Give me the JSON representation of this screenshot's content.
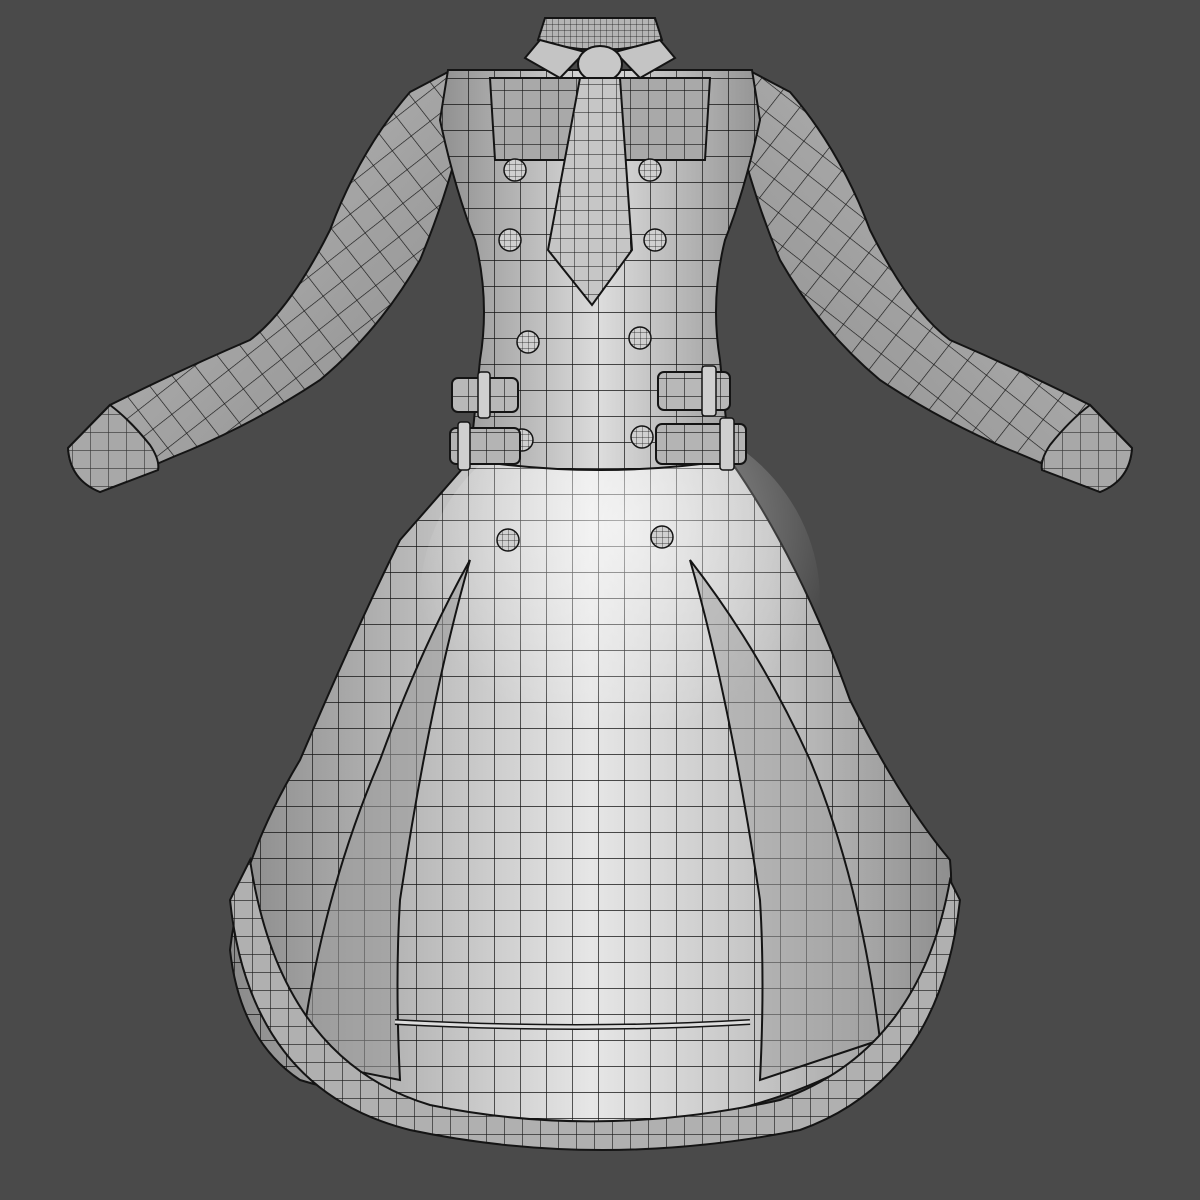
{
  "scene": {
    "subject": "dress-wireframe",
    "colors": {
      "background": "#4a4a4a",
      "surface_light": "#e2e2e2",
      "surface_mid": "#b4b4b4",
      "surface_dark": "#7c7c7c",
      "wire": "#141414"
    }
  }
}
